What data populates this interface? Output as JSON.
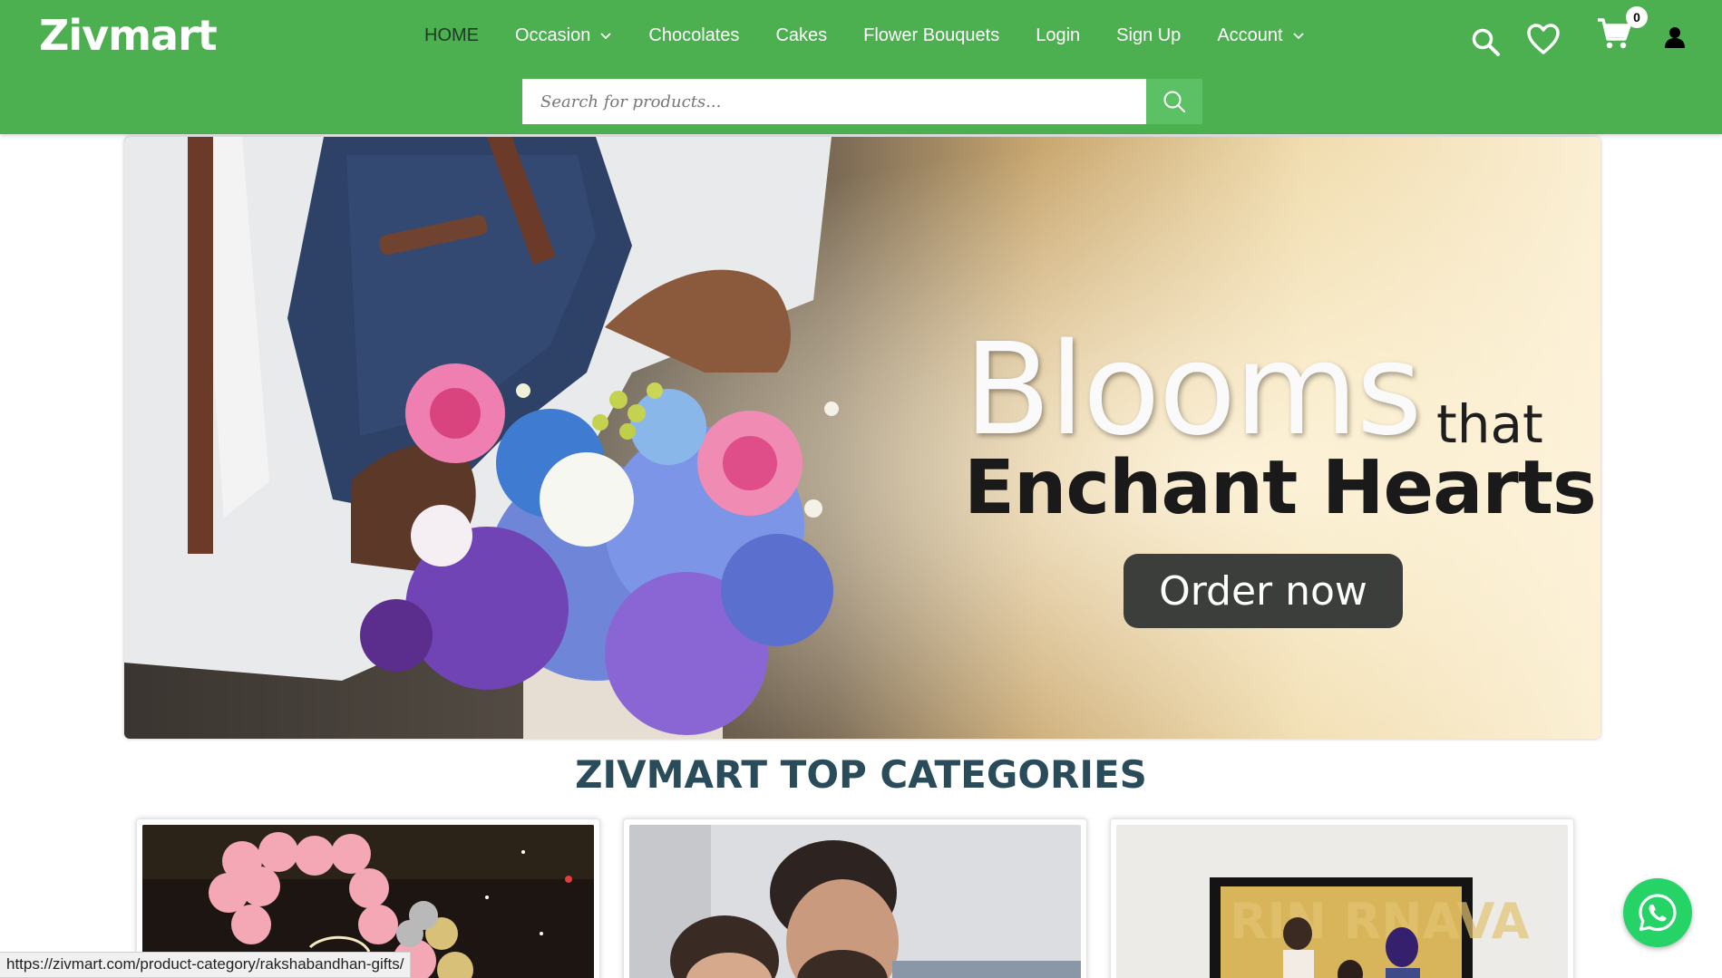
{
  "brand": {
    "logo_text": "Zivmart",
    "color": "#4caf50"
  },
  "nav": {
    "items": [
      {
        "label": "HOME",
        "active": true,
        "dropdown": false
      },
      {
        "label": "Occasion",
        "active": false,
        "dropdown": true
      },
      {
        "label": "Chocolates",
        "active": false,
        "dropdown": false
      },
      {
        "label": "Cakes",
        "active": false,
        "dropdown": false
      },
      {
        "label": "Flower Bouquets",
        "active": false,
        "dropdown": false
      },
      {
        "label": "Login",
        "active": false,
        "dropdown": false
      },
      {
        "label": "Sign Up",
        "active": false,
        "dropdown": false
      },
      {
        "label": "Account",
        "active": false,
        "dropdown": true
      }
    ]
  },
  "header_icons": [
    "search-icon",
    "heart-icon",
    "cart-icon",
    "user-icon"
  ],
  "cart": {
    "count": "0"
  },
  "search": {
    "placeholder": "Search for products..."
  },
  "hero": {
    "headline_big": "Blooms",
    "headline_small": "that",
    "headline_line2": "Enchant Hearts",
    "button_label": "Order now"
  },
  "categories": {
    "title": "ZIVMART TOP CATEGORIES",
    "items": [
      {
        "image": "balloons-party-image"
      },
      {
        "image": "couple-image"
      },
      {
        "image": "photo-frame-image"
      }
    ]
  },
  "status_bar": {
    "url": "https://zivmart.com/product-category/rakshabandhan-gifts/"
  },
  "whatsapp": {
    "icon": "whatsapp-icon",
    "color": "#25d366"
  }
}
